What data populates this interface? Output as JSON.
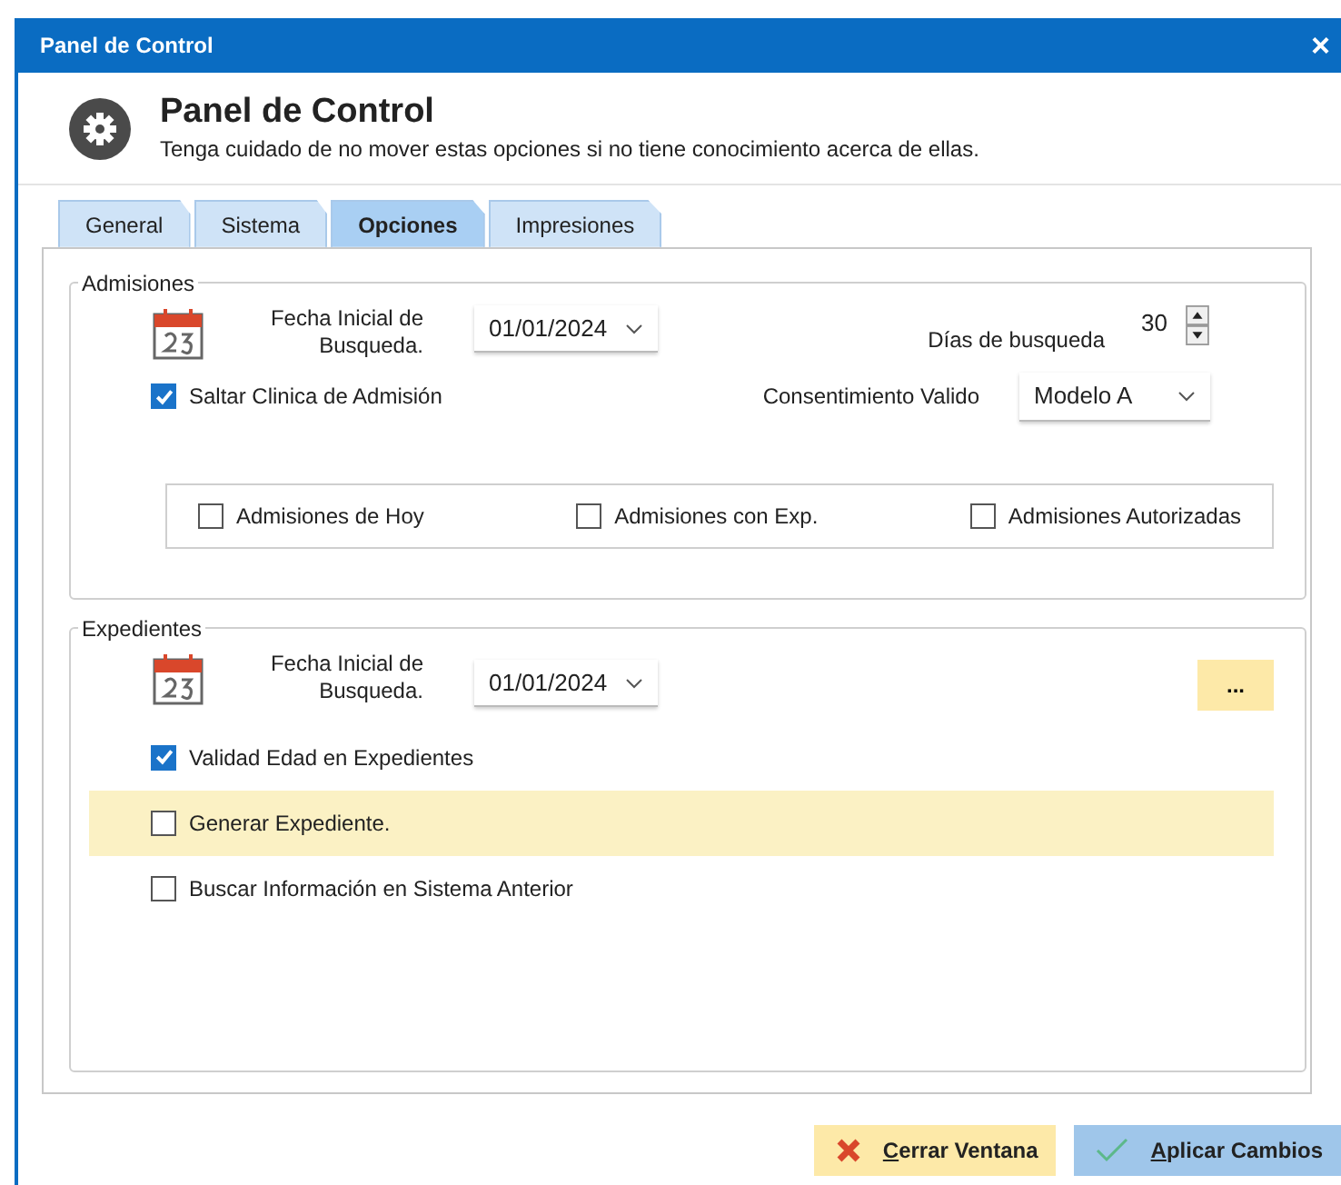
{
  "window": {
    "title": "Panel de Control",
    "close": "×"
  },
  "header": {
    "title": "Panel de Control",
    "subtitle": "Tenga cuidado de no mover estas opciones si no tiene conocimiento acerca de ellas."
  },
  "tabs": [
    {
      "label": "General",
      "selected": false
    },
    {
      "label": "Sistema",
      "selected": false
    },
    {
      "label": "Opciones",
      "selected": true
    },
    {
      "label": "Impresiones",
      "selected": false
    }
  ],
  "admisiones": {
    "title": "Admisiones",
    "date_label": "Fecha Inicial de Busqueda.",
    "date_value": "01/01/2024",
    "days_label": "Días de busqueda",
    "days_value": "30",
    "skip_clinic": {
      "label": "Saltar Clinica de Admisión",
      "checked": true
    },
    "consent_label": "Consentimiento Valido",
    "consent_value": "Modelo A",
    "filters": [
      {
        "label": "Admisiones de Hoy",
        "checked": false
      },
      {
        "label": "Admisiones con Exp.",
        "checked": false
      },
      {
        "label": "Admisiones Autorizadas",
        "checked": false
      }
    ]
  },
  "expedientes": {
    "title": "Expedientes",
    "date_label": "Fecha Inicial de Busqueda.",
    "date_value": "01/01/2024",
    "more_button": "...",
    "options": [
      {
        "label": "Validad Edad en Expedientes",
        "checked": true,
        "highlighted": false
      },
      {
        "label": "Generar Expediente.",
        "checked": false,
        "highlighted": true
      },
      {
        "label": "Buscar Información en Sistema Anterior",
        "checked": false,
        "highlighted": false
      }
    ]
  },
  "buttons": [
    {
      "label": "Cerrar Ventana",
      "kind": "close"
    },
    {
      "label": "Aplicar Cambios",
      "kind": "apply"
    }
  ]
}
